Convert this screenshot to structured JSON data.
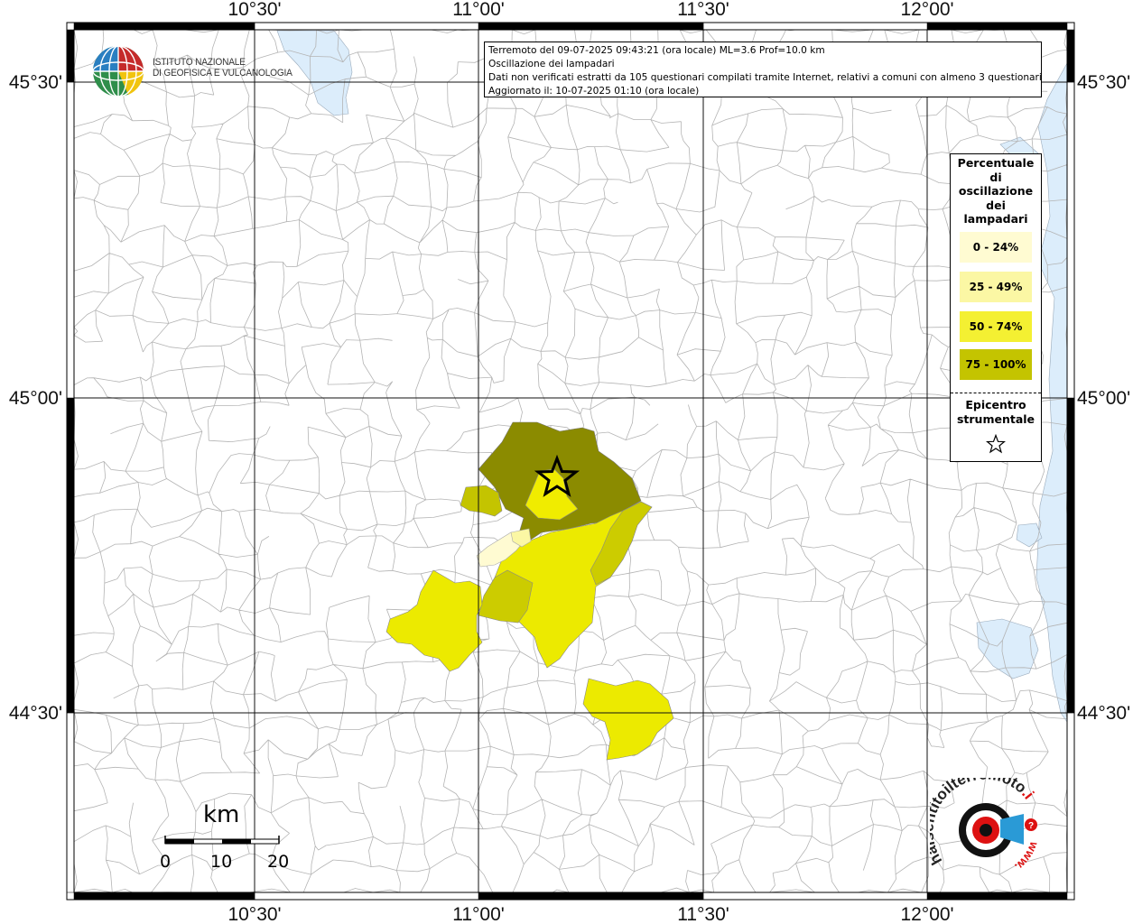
{
  "map": {
    "top_lon_labels": [
      "10°30'",
      "11°00'",
      "11°30'",
      "12°00'"
    ],
    "bottom_lon_labels": [
      "10°30'",
      "11°00'",
      "11°30'",
      "12°00'"
    ],
    "left_lat_labels": [
      "45°30'",
      "45°00'",
      "44°30'"
    ],
    "right_lat_labels": [
      "45°30'",
      "45°00'",
      "44°30'"
    ],
    "land_color": "#ffffff",
    "water_color": "#dcedfb",
    "grid_color": "#111111",
    "boundary_color": "#b4b4b4"
  },
  "info_box": {
    "line1": "Terremoto del 09-07-2025 09:43:21 (ora locale) ML=3.6 Prof=10.0 km",
    "line2": "Oscillazione dei lampadari",
    "line3": "Dati non verificati estratti da 105 questionari compilati tramite Internet, relativi a comuni con almeno 3 questionari.",
    "line4": "Aggiornato il: 10-07-2025 01:10 (ora locale)"
  },
  "institute": {
    "line1": "ISTITUTO NAZIONALE",
    "line2": "DI GEOFISICA E VULCANOLOGIA"
  },
  "legend": {
    "title_lines": [
      "Percentuale",
      "di",
      "oscillazione",
      "dei",
      "lampadari"
    ],
    "classes": [
      {
        "label": "0 - 24%",
        "color": "#fffbd2"
      },
      {
        "label": "25 - 49%",
        "color": "#fbf7a4"
      },
      {
        "label": "50 - 74%",
        "color": "#f4f032"
      },
      {
        "label": "75 - 100%",
        "color": "#c4c400"
      }
    ],
    "epicenter_lines": [
      "Epicentro",
      "strumentale"
    ],
    "epicenter_icon": "star-outline-icon"
  },
  "scale_bar": {
    "unit": "km",
    "ticks": [
      "0",
      "10",
      "20"
    ]
  },
  "site_logo": {
    "text_black": "haisentitoilterremoto",
    "text_red": ".it",
    "text_url": "www."
  }
}
